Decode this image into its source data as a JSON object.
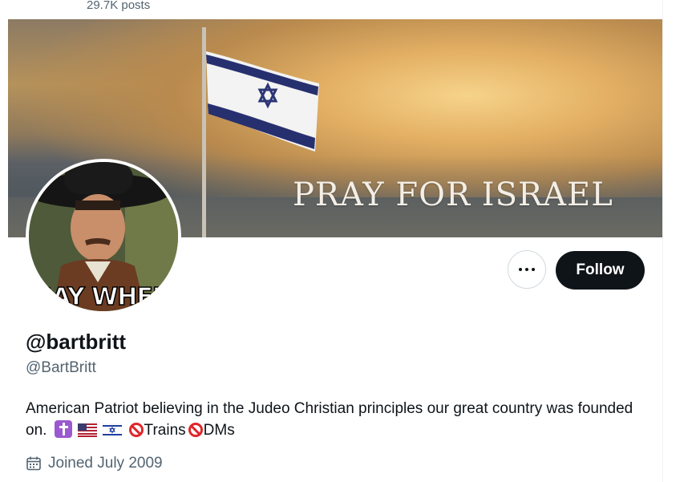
{
  "header": {
    "post_count": "29.7K posts"
  },
  "banner": {
    "text": "PRAY FOR ISRAEL"
  },
  "avatar": {
    "caption": "SAY WHEN"
  },
  "actions": {
    "more_label": "More",
    "follow_label": "Follow"
  },
  "profile": {
    "display_name": "@bartbritt",
    "handle": "@BartBritt",
    "bio_text": "American Patriot believing in the Judeo Christian principles our great country was founded on.",
    "bio_word_trains": "Trains",
    "bio_word_dms": "DMs",
    "joined": "Joined July 2009"
  },
  "icons": {
    "calendar": "calendar-icon",
    "more": "more-horizontal-icon"
  },
  "colors": {
    "follow_bg": "#0f1419",
    "muted_text": "#536471",
    "no_symbol": "#e0262b"
  }
}
